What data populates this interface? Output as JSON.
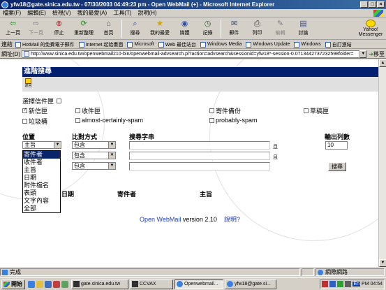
{
  "window": {
    "title": "yfw18@gate.sinica.edu.tw - 07/30/2003 04:49:23 pm - Open WebMail (+) - Microsoft Internet Explorer",
    "btn_min": "_",
    "btn_max": "□",
    "btn_close": "×"
  },
  "menu": [
    "檔案(F)",
    "編輯(E)",
    "檢視(V)",
    "我的最愛(A)",
    "工具(T)",
    "說明(H)"
  ],
  "toolbar": {
    "back": "上一頁",
    "forward": "下一頁",
    "stop": "停止",
    "refresh": "重新整理",
    "home": "首頁",
    "search": "搜尋",
    "favorites": "我的最愛",
    "media": "媒體",
    "history": "記錄",
    "mail": "郵件",
    "print": "列印",
    "edit": "編輯",
    "discuss": "討論",
    "yahoo": "Yahoo! Messenger"
  },
  "links": {
    "label": "連結",
    "items": [
      "HotMail 的免費電子郵件",
      "Internet 起始畫面",
      "Microsoft",
      "Web 最佳站台",
      "Windows Media",
      "Windows Update",
      "Windows",
      "自訂連結"
    ]
  },
  "address": {
    "label": "網址(D)",
    "url": "http://www.sinica.edu.tw/openwebmail210-bin/openwebmail-advsearch.pl?action=advsearch&sessionid=yfw18*-session-0.0713442737232598folder=",
    "go": "移至"
  },
  "page": {
    "title": "進階搜尋",
    "back_icon_label": "返回",
    "select_folder_label": "選擇信件匣",
    "folders": [
      {
        "label": "新信匣",
        "checked": true
      },
      {
        "label": "收件匣",
        "checked": false
      },
      {
        "label": "寄件備份",
        "checked": false
      },
      {
        "label": "草稿匣",
        "checked": false
      },
      {
        "label": "垃圾桶",
        "checked": false
      },
      {
        "label": "almost-certainly-spam",
        "checked": false
      },
      {
        "label": "probably-spam",
        "checked": false
      }
    ],
    "col_position": "位置",
    "col_compare": "比對方式",
    "col_search_text": "搜尋字串",
    "col_output_rows": "輸出列數",
    "row1_position": "主旨",
    "row_compare": "包含",
    "q_mark": "且",
    "output_rows_value": "10",
    "search_button": "搜尋",
    "dropdown_options": [
      "寄件者",
      "收件者",
      "主旨",
      "日期",
      "附件檔名",
      "表頭",
      "文字內容",
      "全部"
    ],
    "result_headers": {
      "date": "日期",
      "sender": "寄件者",
      "subject": "主旨"
    },
    "footer_app": "Open WebMail",
    "footer_version": "version 2.10",
    "footer_help": "說明?"
  },
  "status": {
    "text": "完成",
    "zone": "網際網路"
  },
  "taskbar": {
    "start": "開始",
    "tasks": [
      "gate.sinica.edu.tw",
      "CCVAX",
      "Openwebmail...",
      "yfw18@gate.si..."
    ],
    "clock": "PM 04:54",
    "tray_label": "En"
  }
}
